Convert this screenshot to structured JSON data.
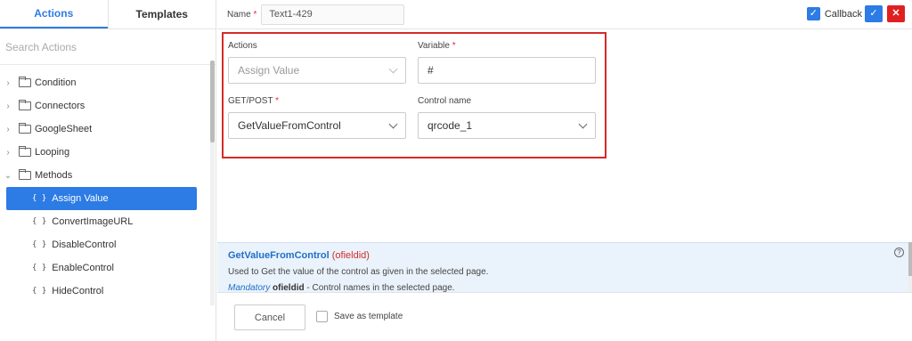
{
  "left_panel": {
    "tabs": [
      {
        "label": "Actions"
      },
      {
        "label": "Templates"
      }
    ],
    "search_placeholder": "Search Actions",
    "groups": [
      {
        "label": "Condition",
        "chevron": "›"
      },
      {
        "label": "Connectors",
        "chevron": "›"
      },
      {
        "label": "GoogleSheet",
        "chevron": "›"
      },
      {
        "label": "Looping",
        "chevron": "›"
      },
      {
        "label": "Methods",
        "chevron": "⌄"
      }
    ],
    "methods": [
      {
        "label": "Assign Value",
        "selected": true
      },
      {
        "label": "ConvertImageURL"
      },
      {
        "label": "DisableControl"
      },
      {
        "label": "EnableControl"
      },
      {
        "label": "HideControl"
      }
    ],
    "brace_glyph": "{ }"
  },
  "topbar": {
    "name_label": "Name",
    "required_mark": "*",
    "name_value": "Text1-429",
    "callback_label": "Callback",
    "callback_checked": true,
    "ok_glyph": "✓",
    "close_glyph": "✕"
  },
  "form": {
    "actions_label": "Actions",
    "actions_value": "Assign Value",
    "variable_label": "Variable",
    "variable_value": "#",
    "getpost_label": "GET/POST",
    "getpost_value": "GetValueFromControl",
    "control_label": "Control name",
    "control_value": "qrcode_1"
  },
  "info": {
    "title": "GetValueFromControl",
    "param": "(ofieldid)",
    "description": "Used to Get the value of the control as given in the selected page.",
    "mandatory_label": "Mandatory",
    "param_name": "ofieldid",
    "param_desc": " - Control names in the selected page.",
    "help_glyph": "?"
  },
  "footer": {
    "cancel_label": "Cancel",
    "save_template_label": "Save as template"
  },
  "colors": {
    "accent": "#2d7be5",
    "danger": "#e02020",
    "highlight_border": "#d62a2a"
  }
}
